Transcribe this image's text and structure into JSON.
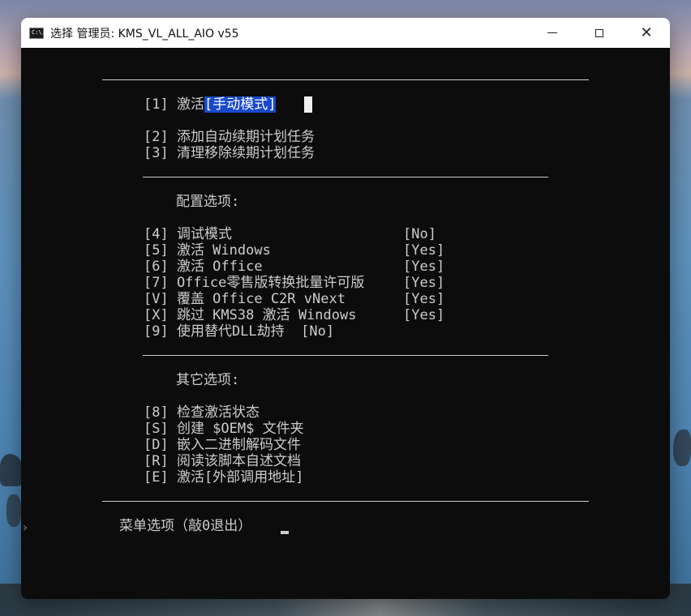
{
  "window": {
    "title": "选择 管理员:  KMS_VL_ALL_AIO v55",
    "app_icon_text": "C:\\."
  },
  "console": {
    "opt1_prefix": "[1] 激活",
    "opt1_selected": "[手动模式]",
    "opt2": "[2] 添加自动续期计划任务",
    "opt3": "[3] 清理移除续期计划任务",
    "config_header": "配置选项:",
    "cfg4_label": "[4] 调试模式",
    "cfg4_value": "[No]",
    "cfg5_label": "[5] 激活 Windows",
    "cfg5_value": "[Yes]",
    "cfg6_label": "[6] 激活 Office",
    "cfg6_value": "[Yes]",
    "cfg7_label": "[7] Office零售版转换批量许可版",
    "cfg7_value": "[Yes]",
    "cfgV_label": "[V] 覆盖 Office C2R vNext",
    "cfgV_value": "[Yes]",
    "cfgX_label": "[X] 跳过 KMS38 激活 Windows",
    "cfgX_value": "[Yes]",
    "cfg9_line": "[9] 使用替代DLL劫持  [No]",
    "other_header": "其它选项:",
    "opt8": "[8] 检查激活状态",
    "optS": "[S] 创建 $OEM$ 文件夹",
    "optD": "[D] 嵌入二进制解码文件",
    "optR": "[R] 阅读该脚本自述文档",
    "optE": "[E] 激活[外部调用地址]",
    "prompt": "菜单选项（敲0退出）"
  }
}
